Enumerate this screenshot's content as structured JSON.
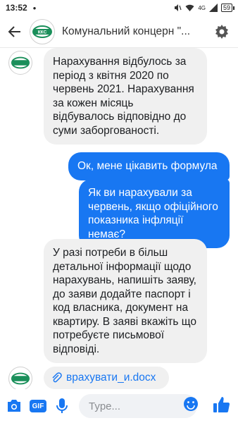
{
  "status_bar": {
    "time": "13:52",
    "dot": "•",
    "network": "4G",
    "battery": "59"
  },
  "header": {
    "title": "Комунальний концерн \"...",
    "logo_text": "ККС"
  },
  "messages": [
    {
      "direction": "incoming",
      "text": "Нарахування відбулось за період з квітня 2020 по червень 2021. Нарахування за кожен місяць відбувалось відповідно до суми заборгованості."
    },
    {
      "direction": "outgoing",
      "text": "Ок, мене цікавить формула"
    },
    {
      "direction": "outgoing",
      "text": "Як ви нарахували за червень, якщо офіційного показника інфляції немає?"
    },
    {
      "direction": "incoming",
      "text": "У разі потреби в більш детальної інформації щодо нарахувань, напишіть заяву, до заяви додайте паспорт і код власника, документ на квартиру. В заяві вкажіть що потребуєте письмової відповіді."
    }
  ],
  "attachment": {
    "label": "врахувати_и.docx"
  },
  "composer": {
    "gif_label": "GIF",
    "placeholder": "Type..."
  },
  "colors": {
    "accent": "#1877f2",
    "incoming_bubble": "#f0f0f0",
    "logo_green": "#1a8f5a"
  }
}
